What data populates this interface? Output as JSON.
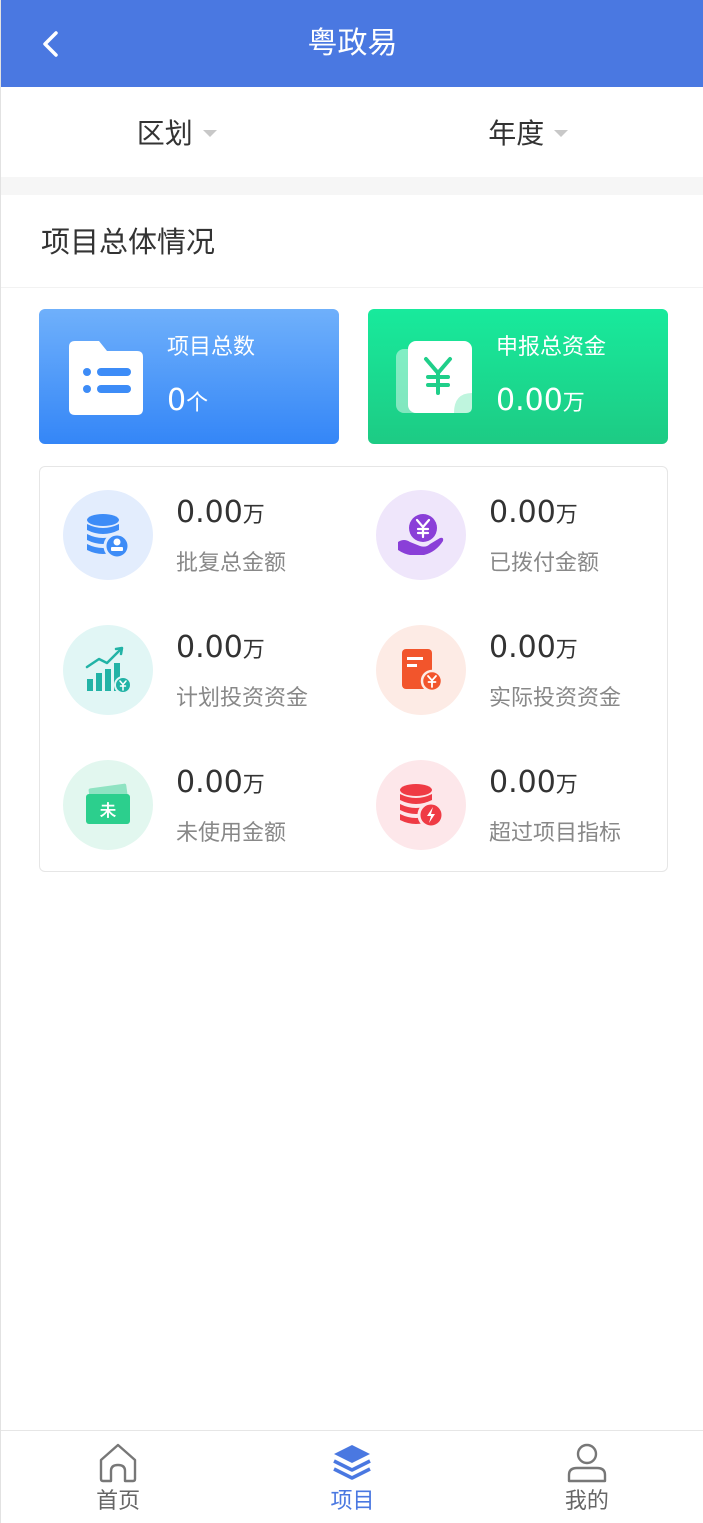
{
  "header": {
    "title": "粤政易"
  },
  "filters": [
    {
      "label": "区划"
    },
    {
      "label": "年度"
    }
  ],
  "section": {
    "title": "项目总体情况"
  },
  "cards": {
    "project_count": {
      "label": "项目总数",
      "value": "0",
      "unit": "个",
      "icon": "folder-list-icon"
    },
    "declared_funds": {
      "label": "申报总资金",
      "value": "0.00",
      "unit": "万",
      "icon": "yen-document-icon"
    }
  },
  "stats": [
    {
      "value": "0.00",
      "unit": "万",
      "label": "批复总金额",
      "icon": "coins-stamp-icon",
      "bg": "#e3edfd"
    },
    {
      "value": "0.00",
      "unit": "万",
      "label": "已拨付金额",
      "icon": "hand-yen-icon",
      "bg": "#efe6fb"
    },
    {
      "value": "0.00",
      "unit": "万",
      "label": "计划投资资金",
      "icon": "growth-chart-icon",
      "bg": "#e1f6f5"
    },
    {
      "value": "0.00",
      "unit": "万",
      "label": "实际投资资金",
      "icon": "receipt-yen-icon",
      "bg": "#fdebe5"
    },
    {
      "value": "0.00",
      "unit": "万",
      "label": "未使用金额",
      "icon": "unused-ticket-icon",
      "bg": "#e2f7ef"
    },
    {
      "value": "0.00",
      "unit": "万",
      "label": "超过项目指标",
      "icon": "coins-alert-icon",
      "bg": "#fde7ea"
    }
  ],
  "tabbar": [
    {
      "label": "首页",
      "icon": "home-icon",
      "active": false
    },
    {
      "label": "项目",
      "icon": "layers-icon",
      "active": true
    },
    {
      "label": "我的",
      "icon": "user-icon",
      "active": false
    }
  ],
  "colors": {
    "primary": "#4a78e1",
    "blue_card": "#3486f7",
    "green_card": "#1dcb84"
  }
}
